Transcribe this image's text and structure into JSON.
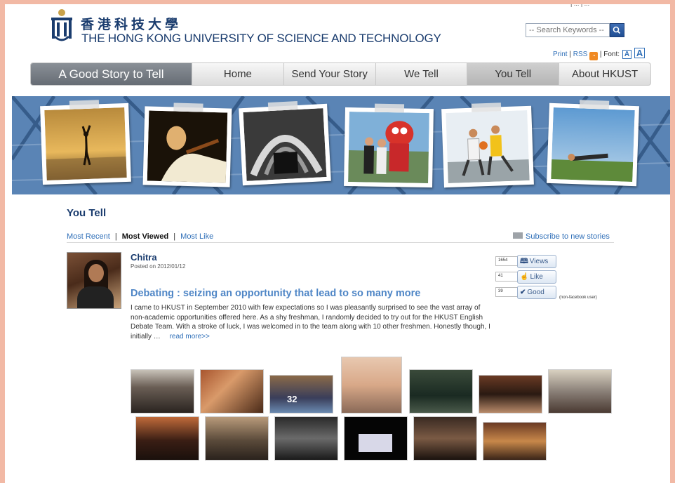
{
  "header": {
    "logo_cn": "香港科技大學",
    "logo_en": "THE HONG KONG UNIVERSITY OF SCIENCE AND TECHNOLOGY",
    "top_cut_text": "|  ...  |  ...",
    "search_placeholder": "-- Search Keywords --",
    "print_label": "Print",
    "rss_label": "RSS",
    "font_label": "Font:",
    "font_small": "A",
    "font_large": "A"
  },
  "nav": {
    "brand": "A Good Story to Tell",
    "items": [
      "Home",
      "Send Your Story",
      "We Tell",
      "You Tell",
      "About HKUST"
    ],
    "active": "You Tell"
  },
  "content": {
    "title": "You Tell",
    "filters": [
      "Most Recent",
      "Most Viewed",
      "Most Like"
    ],
    "current_filter": "Most Viewed",
    "separator": "|",
    "subscribe": "Subscribe to new stories"
  },
  "story": {
    "author": "Chitra",
    "posted": "Posted on 2012/01/12",
    "title": "Debating : seizing an opportunity that lead to so many more",
    "body": "I came to HKUST in September 2010 with few expectations so I was pleasantly surprised to see the vast array of non-academic opportunities offered here. As a shy freshman, I randomly decided to try out for the HKUST English Debate Team. With a stroke of luck, I was welcomed in to the team along with 10 other freshmen. Honestly though, I initially …",
    "read_more": "read more>>",
    "views_count": "1654",
    "views_label": "Views",
    "like_count": "41",
    "like_label": "Like",
    "good_count": "39",
    "good_label": "Good",
    "non_facebook_note": "(non-facebook user)"
  },
  "icons": {
    "search": "search-icon",
    "rss": "rss-icon",
    "mail": "mail-icon",
    "book": "book-icon",
    "thumbs_up": "thumbs-up-icon",
    "check": "check-icon"
  },
  "colors": {
    "frame": "#f2b9a5",
    "brand_blue": "#1a3c6e",
    "link_blue": "#2f6fb8",
    "story_title": "#4f86c6",
    "nav_brand_bg": "#6f757d",
    "banner_bg": "#4c77a9"
  }
}
